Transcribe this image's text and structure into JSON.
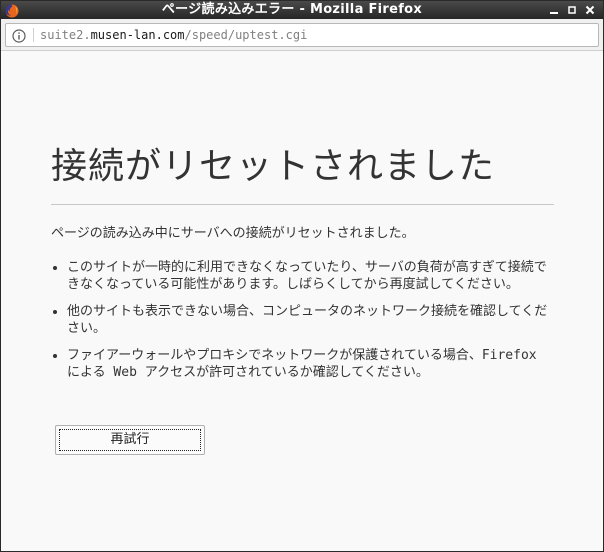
{
  "window": {
    "title": "ページ読み込みエラー - Mozilla Firefox",
    "app_icon": "firefox-icon",
    "controls": {
      "minimize_icon": "minimize-icon",
      "maximize_icon": "maximize-icon",
      "close_icon": "close-icon"
    }
  },
  "navbar": {
    "info_icon": "info-icon",
    "url": {
      "prefix": "suite2.",
      "domain": "musen-lan.com",
      "path": "/speed/uptest.cgi"
    }
  },
  "error_page": {
    "title": "接続がリセットされました",
    "intro": "ページの読み込み中にサーバへの接続がリセットされました。",
    "reasons": [
      "このサイトが一時的に利用できなくなっていたり、サーバの負荷が高すぎて接続できなくなっている可能性があります。しばらくしてから再度試してください。",
      "他のサイトも表示できない場合、コンピュータのネットワーク接続を確認してください。",
      "ファイアーウォールやプロキシでネットワークが保護されている場合、Firefox による Web アクセスが許可されているか確認してください。"
    ],
    "retry_label": "再試行"
  },
  "colors": {
    "titlebar": "#262626",
    "page_background": "#f9f9fa",
    "text": "#333333",
    "url_dim": "#808080"
  }
}
